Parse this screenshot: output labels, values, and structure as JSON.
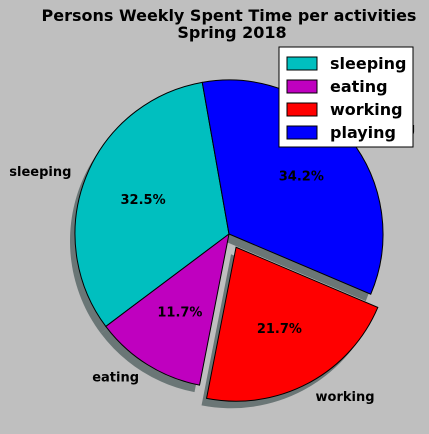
{
  "chart_data": {
    "type": "pie",
    "title": "Persons Weekly Spent Time per activities",
    "subtitle": "Spring 2018",
    "categories": [
      "sleeping",
      "eating",
      "working",
      "playing"
    ],
    "values": [
      32.5,
      11.7,
      21.7,
      34.2
    ],
    "percent_labels": [
      "32.5%",
      "11.7%",
      "21.7%",
      "34.2%"
    ],
    "colors": [
      "#00bfbf",
      "#bf00bf",
      "#ff0000",
      "#0000ff"
    ],
    "exploded": [
      false,
      false,
      true,
      false
    ],
    "shadow": true,
    "start_angle_deg": 100,
    "direction": "counterclockwise",
    "legend": {
      "position": "top-right",
      "entries": [
        "sleeping",
        "eating",
        "working",
        "playing"
      ]
    }
  }
}
